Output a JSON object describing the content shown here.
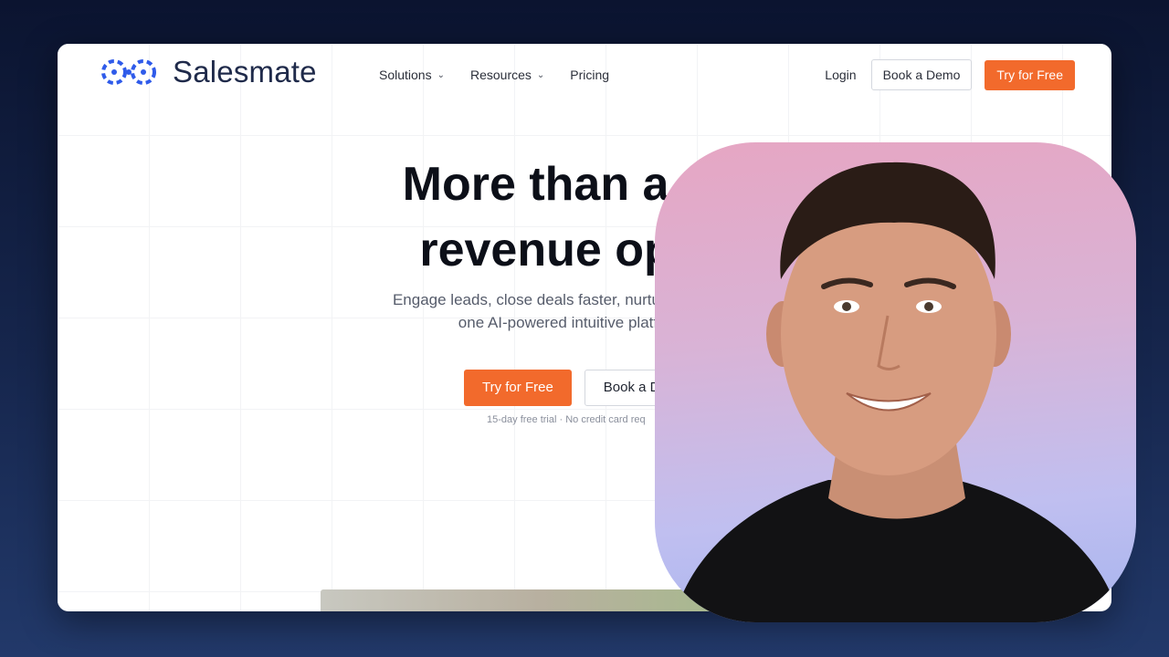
{
  "nav": {
    "brand": "Salesmate",
    "menu": [
      {
        "label": "Solutions",
        "has_dropdown": true
      },
      {
        "label": "Resources",
        "has_dropdown": true
      },
      {
        "label": "Pricing",
        "has_dropdown": false
      }
    ],
    "login": "Login",
    "book_demo": "Book a Demo",
    "try_free": "Try for Free"
  },
  "hero": {
    "title_line1": "More than a CRM",
    "title_line2": "revenue operati",
    "subtitle_line1": "Engage leads, close deals faster, nurture relationships, and",
    "subtitle_line2": "one AI-powered intuitive platform design",
    "cta_primary": "Try for Free",
    "cta_secondary": "Book a D",
    "note": "15-day free trial · No credit card req"
  },
  "colors": {
    "accent": "#f26a2c",
    "brand_blue": "#2f5bea",
    "text_dark": "#0c0f18",
    "background_navy": "#0b1430"
  }
}
